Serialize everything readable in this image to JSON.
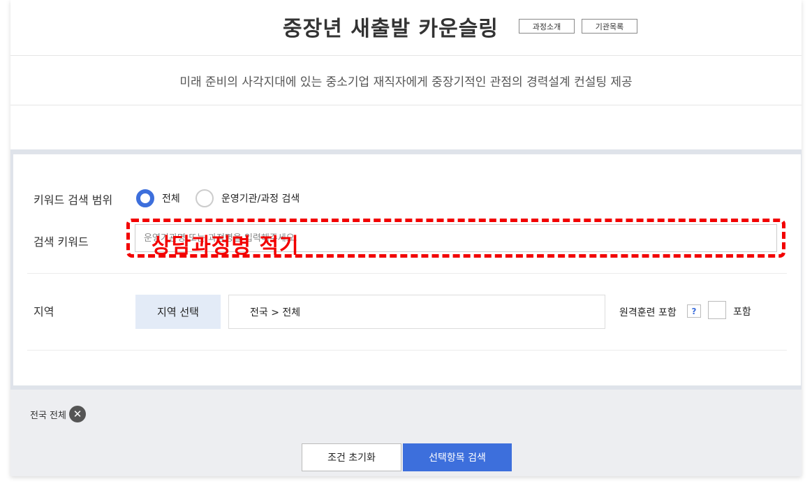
{
  "header": {
    "title": "중장년 새출발 카운슬링",
    "course_intro_button": "과정소개",
    "institution_list_button": "기관목록"
  },
  "description": "미래 준비의 사각지대에 있는 중소기업 재직자에게 중장기적인 관점의 경력설계 컨설팅 제공",
  "search": {
    "keyword_scope_label": "키워드 검색 범위",
    "scope_options": [
      {
        "label": "전체",
        "selected": true
      },
      {
        "label": "운영기관/과정 검색",
        "selected": false
      }
    ],
    "keyword_label": "검색 키워드",
    "keyword_placeholder": "운영기관명 또는 과정명을 입력해주세요.",
    "keyword_value": "",
    "annotation": "상담과정명 적기",
    "region_label": "지역",
    "region_select_button": "지역 선택",
    "region_value": "전국 > 전체",
    "remote_training_label": "원격훈련 포함",
    "help_icon_text": "?",
    "include_checkbox_label": "포함",
    "include_checked": false
  },
  "selected_filters": {
    "tags": [
      {
        "label": "전국 전체",
        "remove_icon": "close-circle-icon"
      }
    ]
  },
  "actions": {
    "reset_button": "조건 초기화",
    "search_button": "선택항목 검색"
  },
  "colors": {
    "accent": "#3d6fdc",
    "annotation_red": "#f20000",
    "region_button_bg": "#e3ebf7",
    "lower_bg": "#edeef1"
  }
}
